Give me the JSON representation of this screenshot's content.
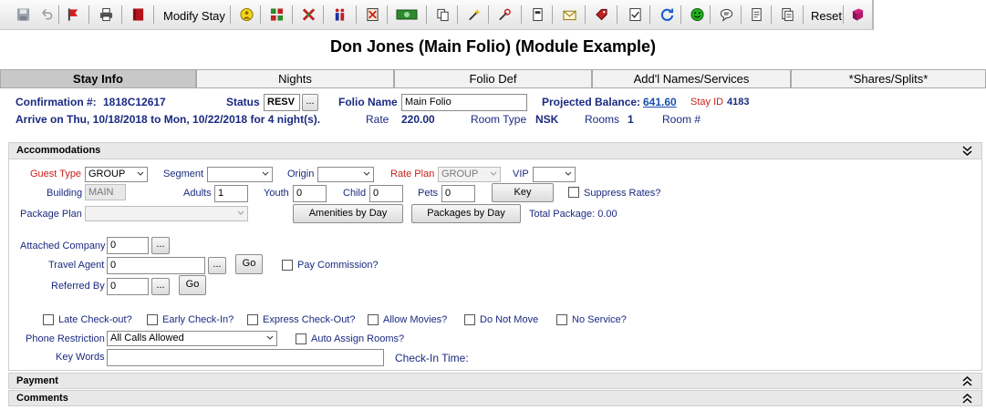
{
  "toolbar": {
    "modify_stay_label": "Modify Stay",
    "reset_label": "Reset",
    "icons": [
      "save-icon",
      "undo-icon",
      "red-flag-icon",
      "print-icon",
      "red-book-icon",
      "person-coin-icon",
      "group-grid-icon",
      "group-x-icon",
      "couple-icon",
      "cancel-doc-icon",
      "cash-icon",
      "copy-icon",
      "wand-icon",
      "satellite-icon",
      "keycard-icon",
      "envelope-icon",
      "tag-icon",
      "checklist-icon",
      "refresh-icon",
      "smiley-icon",
      "chat-icon",
      "document-icon",
      "documents-icon",
      "spell-book-icon"
    ]
  },
  "title": "Don Jones (Main Folio) (Module Example)",
  "tabs": [
    "Stay Info",
    "Nights",
    "Folio Def",
    "Add'l Names/Services",
    "*Shares/Splits*"
  ],
  "summary": {
    "confirmation_label": "Confirmation #:",
    "confirmation_value": "1818C12617",
    "status_label": "Status",
    "status_value": "RESV",
    "folio_name_label": "Folio Name",
    "folio_name_value": "Main Folio",
    "projected_balance_label": "Projected Balance:",
    "projected_balance_value": "641.60",
    "stay_id_label": "Stay ID",
    "stay_id_value": "4183",
    "arrive_text": "Arrive on Thu, 10/18/2018 to Mon, 10/22/2018 for 4 night(s).",
    "rate_label": "Rate",
    "rate_value": "220.00",
    "room_type_label": "Room Type",
    "room_type_value": "NSK",
    "rooms_label": "Rooms",
    "rooms_value": "1",
    "room_num_label": "Room #"
  },
  "accommodations": {
    "header": "Accommodations",
    "guest_type_label": "Guest Type",
    "guest_type_value": "GROUP",
    "segment_label": "Segment",
    "segment_value": "",
    "origin_label": "Origin",
    "origin_value": "",
    "rate_plan_label": "Rate Plan",
    "rate_plan_value": "GROUP",
    "vip_label": "VIP",
    "vip_value": "",
    "building_label": "Building",
    "building_value": "MAIN",
    "adults_label": "Adults",
    "adults_value": "1",
    "youth_label": "Youth",
    "youth_value": "0",
    "child_label": "Child",
    "child_value": "0",
    "pets_label": "Pets",
    "pets_value": "0",
    "key_label": "Key",
    "suppress_rates_label": "Suppress Rates?",
    "package_plan_label": "Package Plan",
    "package_plan_value": "",
    "amenities_label": "Amenities by Day",
    "packages_label": "Packages by Day",
    "total_package_label": "Total Package: 0.00",
    "attached_company_label": "Attached Company",
    "attached_company_value": "0",
    "travel_agent_label": "Travel Agent",
    "travel_agent_value": "0",
    "go_label": "Go",
    "pay_commission_label": "Pay Commission?",
    "referred_by_label": "Referred By",
    "referred_by_value": "0",
    "ellipsis_label": "...",
    "late_checkout_label": "Late Check-out?",
    "early_checkin_label": "Early Check-In?",
    "express_checkout_label": "Express Check-Out?",
    "allow_movies_label": "Allow Movies?",
    "do_not_move_label": "Do Not Move",
    "no_service_label": "No Service?",
    "phone_restriction_label": "Phone Restriction",
    "phone_restriction_value": "All Calls Allowed",
    "auto_assign_label": "Auto Assign Rooms?",
    "key_words_label": "Key Words",
    "key_words_value": "",
    "checkin_time_label": "Check-In Time:"
  },
  "payment_header": "Payment",
  "comments_header": "Comments",
  "colors": {
    "label_blue": "#1a2a80",
    "label_red": "#c8201a",
    "link_blue": "#1a4fb0"
  }
}
